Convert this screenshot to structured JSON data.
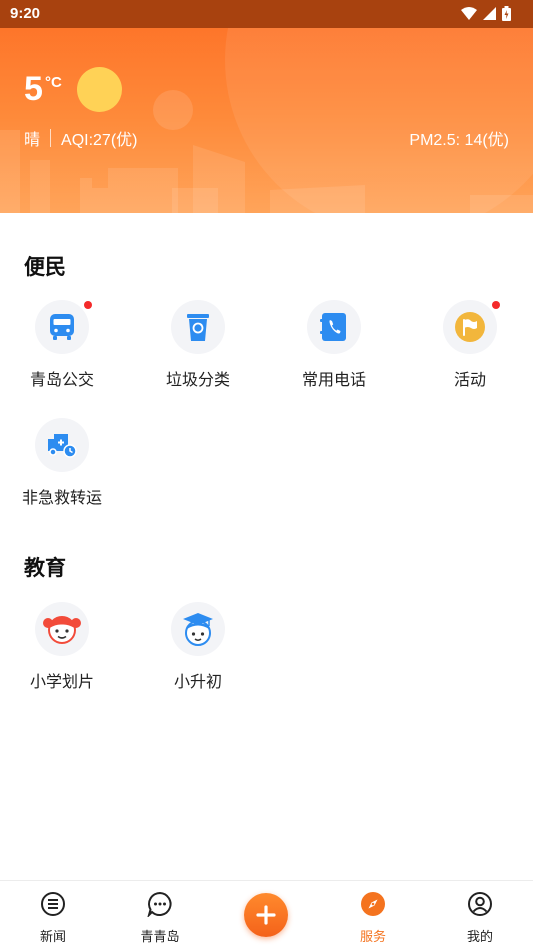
{
  "status_bar": {
    "time": "9:20"
  },
  "weather": {
    "temperature": "5",
    "unit": "°C",
    "condition": "晴",
    "aqi": "AQI:27(优)",
    "pm25": "PM2.5: 14(优)"
  },
  "sections": [
    {
      "title": "便民",
      "items": [
        {
          "label": "青岛公交",
          "icon": "bus-icon",
          "badge": true
        },
        {
          "label": "垃圾分类",
          "icon": "recycle-bin-icon",
          "badge": false
        },
        {
          "label": "常用电话",
          "icon": "phone-book-icon",
          "badge": false
        },
        {
          "label": "活动",
          "icon": "flag-icon",
          "badge": true
        },
        {
          "label": "非急救转运",
          "icon": "ambulance-icon",
          "badge": false
        }
      ]
    },
    {
      "title": "教育",
      "items": [
        {
          "label": "小学划片",
          "icon": "girl-face-icon",
          "badge": false
        },
        {
          "label": "小升初",
          "icon": "graduate-icon",
          "badge": false
        }
      ]
    }
  ],
  "tabbar": {
    "items": [
      {
        "label": "新闻",
        "icon": "menu-list-icon",
        "active": false
      },
      {
        "label": "青青岛",
        "icon": "chat-bubble-icon",
        "active": false
      },
      {
        "label": "服务",
        "icon": "compass-icon",
        "active": true
      },
      {
        "label": "我的",
        "icon": "user-icon",
        "active": false
      }
    ],
    "center_icon": "plus-icon"
  },
  "colors": {
    "accent": "#f4731f",
    "header_top": "#fd6f25",
    "status_bar": "#a8420f",
    "badge": "#f42a2a",
    "sun": "#ffd256"
  }
}
